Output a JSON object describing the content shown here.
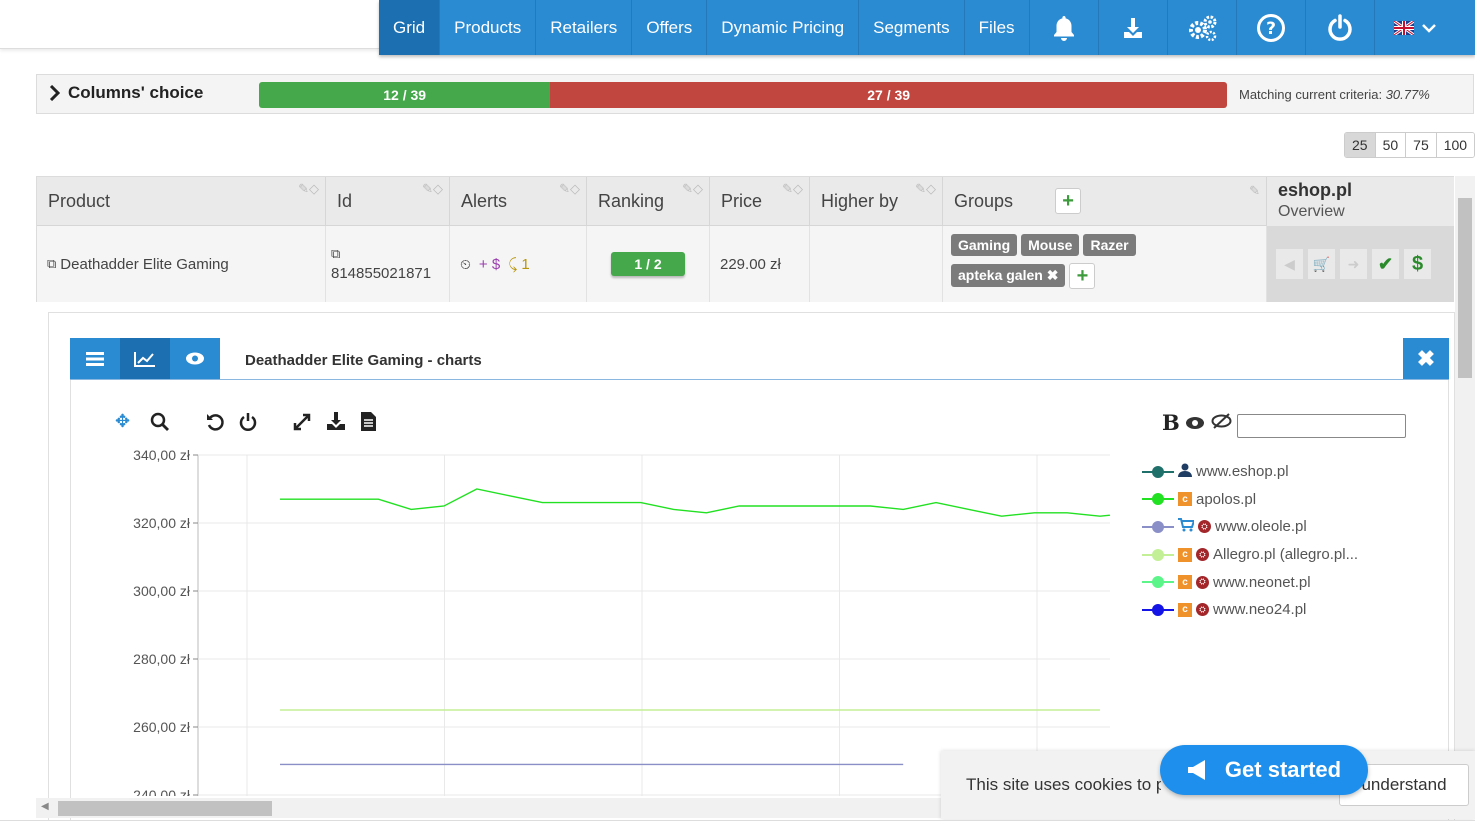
{
  "nav": {
    "items": [
      "Grid",
      "Products",
      "Retailers",
      "Offers",
      "Dynamic Pricing",
      "Segments",
      "Files"
    ],
    "active": "Grid",
    "icons": [
      "bell-icon",
      "download-icon",
      "gears-icon",
      "help-icon",
      "power-icon",
      "flag-uk-icon"
    ]
  },
  "columns_choice": {
    "label": "Columns' choice",
    "green_label": "12 / 39",
    "red_label": "27 / 39",
    "green_fraction": 0.3077,
    "matching_label": "Matching current criteria:",
    "matching_value": "30.77%"
  },
  "page_size": {
    "options": [
      "25",
      "50",
      "75",
      "100"
    ],
    "selected": "25"
  },
  "grid": {
    "headers": [
      "Product",
      "Id",
      "Alerts",
      "Ranking",
      "Price",
      "Higher by",
      "Groups"
    ],
    "row": {
      "product": "Deathadder Elite Gaming",
      "id": "814855021871",
      "alerts": {
        "plus_dollar": "+ $",
        "count": "1"
      },
      "ranking": "1 / 2",
      "price": "229.00 zł",
      "groups": [
        "Gaming",
        "Mouse",
        "Razer",
        "apteka galen"
      ]
    },
    "eshop": {
      "name": "eshop.pl",
      "sub": "Overview"
    }
  },
  "panel": {
    "title": "Deathadder Elite Gaming - charts",
    "filter_bold": "B"
  },
  "chart_data": {
    "type": "line",
    "ylabel": "",
    "y_ticks": [
      "340,00 zł",
      "320,00 zł",
      "300,00 zł",
      "280,00 zł",
      "260,00 zł",
      "240,00 zł"
    ],
    "ylim": [
      240,
      340
    ],
    "series": [
      {
        "name": "www.eshop.pl",
        "color": "#1f6f6a",
        "values": []
      },
      {
        "name": "apolos.pl",
        "color": "#22e022",
        "values": [
          327,
          327,
          327,
          327,
          324,
          325,
          330,
          328,
          326,
          326,
          326,
          326,
          324,
          323,
          325,
          325,
          325,
          325,
          325,
          324,
          326,
          324,
          322,
          323,
          323,
          322,
          323,
          324
        ]
      },
      {
        "name": "www.oleole.pl",
        "color": "#8b8fc8",
        "values": [
          249,
          249,
          249,
          249,
          249,
          249,
          249,
          249,
          249,
          249,
          249,
          249,
          249,
          249,
          249,
          249,
          249,
          249,
          249,
          249
        ]
      },
      {
        "name": "Allegro.pl (allegro.pl...",
        "color": "#c3f096",
        "values": [
          265,
          265,
          265,
          265,
          265,
          265,
          265,
          265,
          265,
          265,
          265,
          265,
          265,
          265,
          265,
          265,
          265,
          265,
          265,
          265,
          265,
          265,
          265,
          265,
          265,
          265
        ]
      },
      {
        "name": "www.neonet.pl",
        "color": "#5cf58a",
        "values": []
      },
      {
        "name": "www.neo24.pl",
        "color": "#1414e6",
        "values": []
      }
    ]
  },
  "cookie": {
    "text": "This site uses cookies to p",
    "button": "understand"
  },
  "get_started": "Get started"
}
